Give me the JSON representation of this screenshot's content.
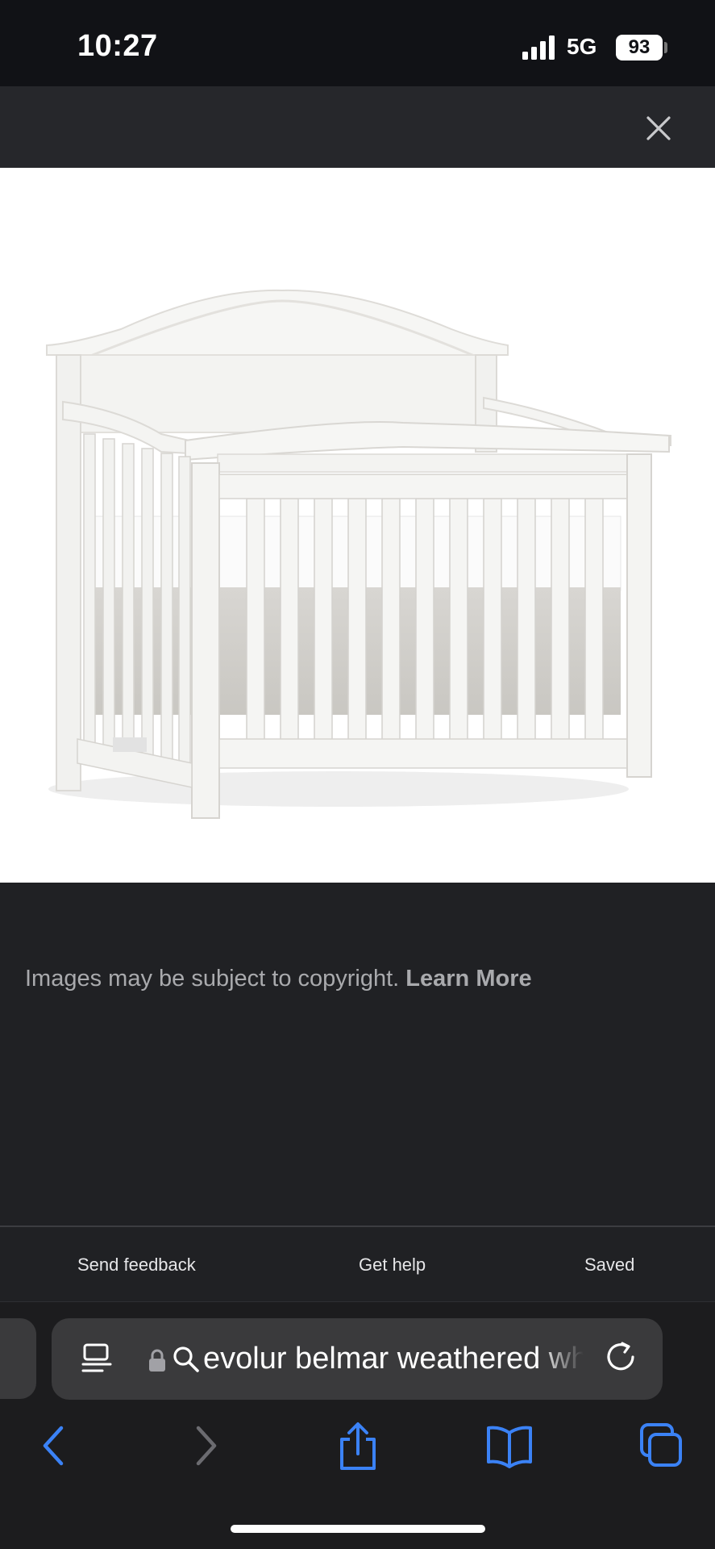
{
  "status_bar": {
    "time": "10:27",
    "network": "5G",
    "battery": "93"
  },
  "viewer": {
    "close_icon": "close-icon",
    "image_subject": "crib"
  },
  "notice": {
    "text": "Images may be subject to copyright.",
    "link": "Learn More"
  },
  "footer": {
    "send_feedback": "Send feedback",
    "get_help": "Get help",
    "saved": "Saved"
  },
  "address_bar": {
    "url": "evolur belmar weathered white crib"
  },
  "toolbar": {
    "icons": [
      "back-icon",
      "forward-icon",
      "share-icon",
      "bookmarks-icon",
      "tabs-icon"
    ]
  },
  "colors": {
    "background": "#202124",
    "accent": "#3b82f6",
    "status_bar": "#111216"
  }
}
